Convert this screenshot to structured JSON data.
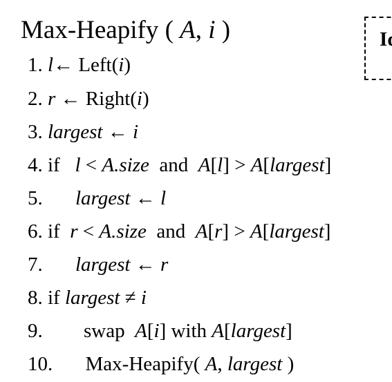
{
  "title": {
    "name": "Max-Heapify",
    "open": " ( ",
    "arg1": "A",
    "sep": ", ",
    "arg2": "i",
    "close": " )"
  },
  "note": {
    "text": "Id"
  },
  "lines": {
    "l1": {
      "num": "1.",
      "a": "l",
      "arrow": "←",
      "b": " Left(",
      "c": "i",
      "d": ")"
    },
    "l2": {
      "num": "2.",
      "a": "r",
      "arrow": "←",
      "b": " Right(",
      "c": "i",
      "d": ")"
    },
    "l3": {
      "num": "3.",
      "a": "largest",
      "arrow": "←",
      "c": "i"
    },
    "l4": {
      "num": "4.",
      "kw": "if",
      "a": "l",
      "lt": " < ",
      "b": "A.size",
      "and": "and",
      "c": "A",
      "d": "[",
      "e": "l",
      "f": "] > ",
      "g": "A",
      "h": "[",
      "j": "largest",
      "k": "]"
    },
    "l5": {
      "num": "5.",
      "a": "largest",
      "arrow": "←",
      "c": "l"
    },
    "l6": {
      "num": "6.",
      "kw": "if",
      "a": "r",
      "lt": " < ",
      "b": "A.size",
      "and": "and",
      "c": "A",
      "d": "[",
      "e": "r",
      "f": "] > ",
      "g": "A",
      "h": "[",
      "j": "largest",
      "k": "]"
    },
    "l7": {
      "num": "7.",
      "a": "largest",
      "arrow": "←",
      "c": "r"
    },
    "l8": {
      "num": "8.",
      "kw": "if",
      "a": "largest",
      "ne": " ≠ ",
      "c": "i"
    },
    "l9": {
      "num": "9.",
      "kw": "swap",
      "a": "A",
      "b": "[",
      "c": "i",
      "d": "] with ",
      "e": "A",
      "f": "[",
      "g": "largest",
      "h": "]"
    },
    "l10": {
      "num": "10.",
      "kw": "Max-Heapify(",
      "a": "A",
      "sep": ", ",
      "b": "largest",
      "c": " )"
    }
  }
}
